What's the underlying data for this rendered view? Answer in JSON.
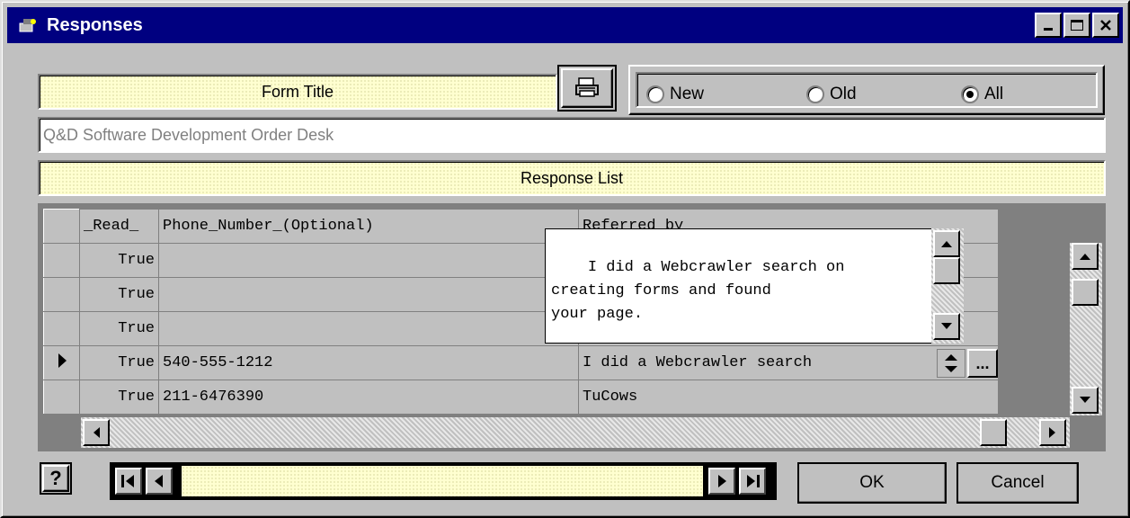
{
  "window": {
    "title": "Responses",
    "title_bar_color": "#000080",
    "icons": [
      "app-icon",
      "minimize-icon",
      "maximize-icon",
      "close-icon"
    ]
  },
  "form": {
    "form_title_label": "Form Title",
    "subtitle_value": "Q&D Software Development Order Desk",
    "response_list_label": "Response List",
    "print_icon": "printer-icon"
  },
  "filter": {
    "options": [
      "New",
      "Old",
      "All"
    ],
    "selected": "All"
  },
  "grid": {
    "columns": [
      "_Read_",
      "Phone_Number_(Optional)",
      "Referred_by"
    ],
    "rows": [
      {
        "read": "True",
        "phone": "",
        "referred": ""
      },
      {
        "read": "True",
        "phone": "",
        "referred": ""
      },
      {
        "read": "True",
        "phone": "",
        "referred": ""
      },
      {
        "read": "True",
        "phone": "540-555-1212",
        "referred": "I did a Webcrawler search"
      },
      {
        "read": "True",
        "phone": "211-6476390",
        "referred": "TuCows"
      }
    ],
    "current_row_index": 3,
    "memo_text": "I did a Webcrawler search on\ncreating forms and found\nyour page.",
    "ellipsis_label": "..."
  },
  "footer": {
    "help_label": "?",
    "ok_label": "OK",
    "cancel_label": "Cancel"
  }
}
